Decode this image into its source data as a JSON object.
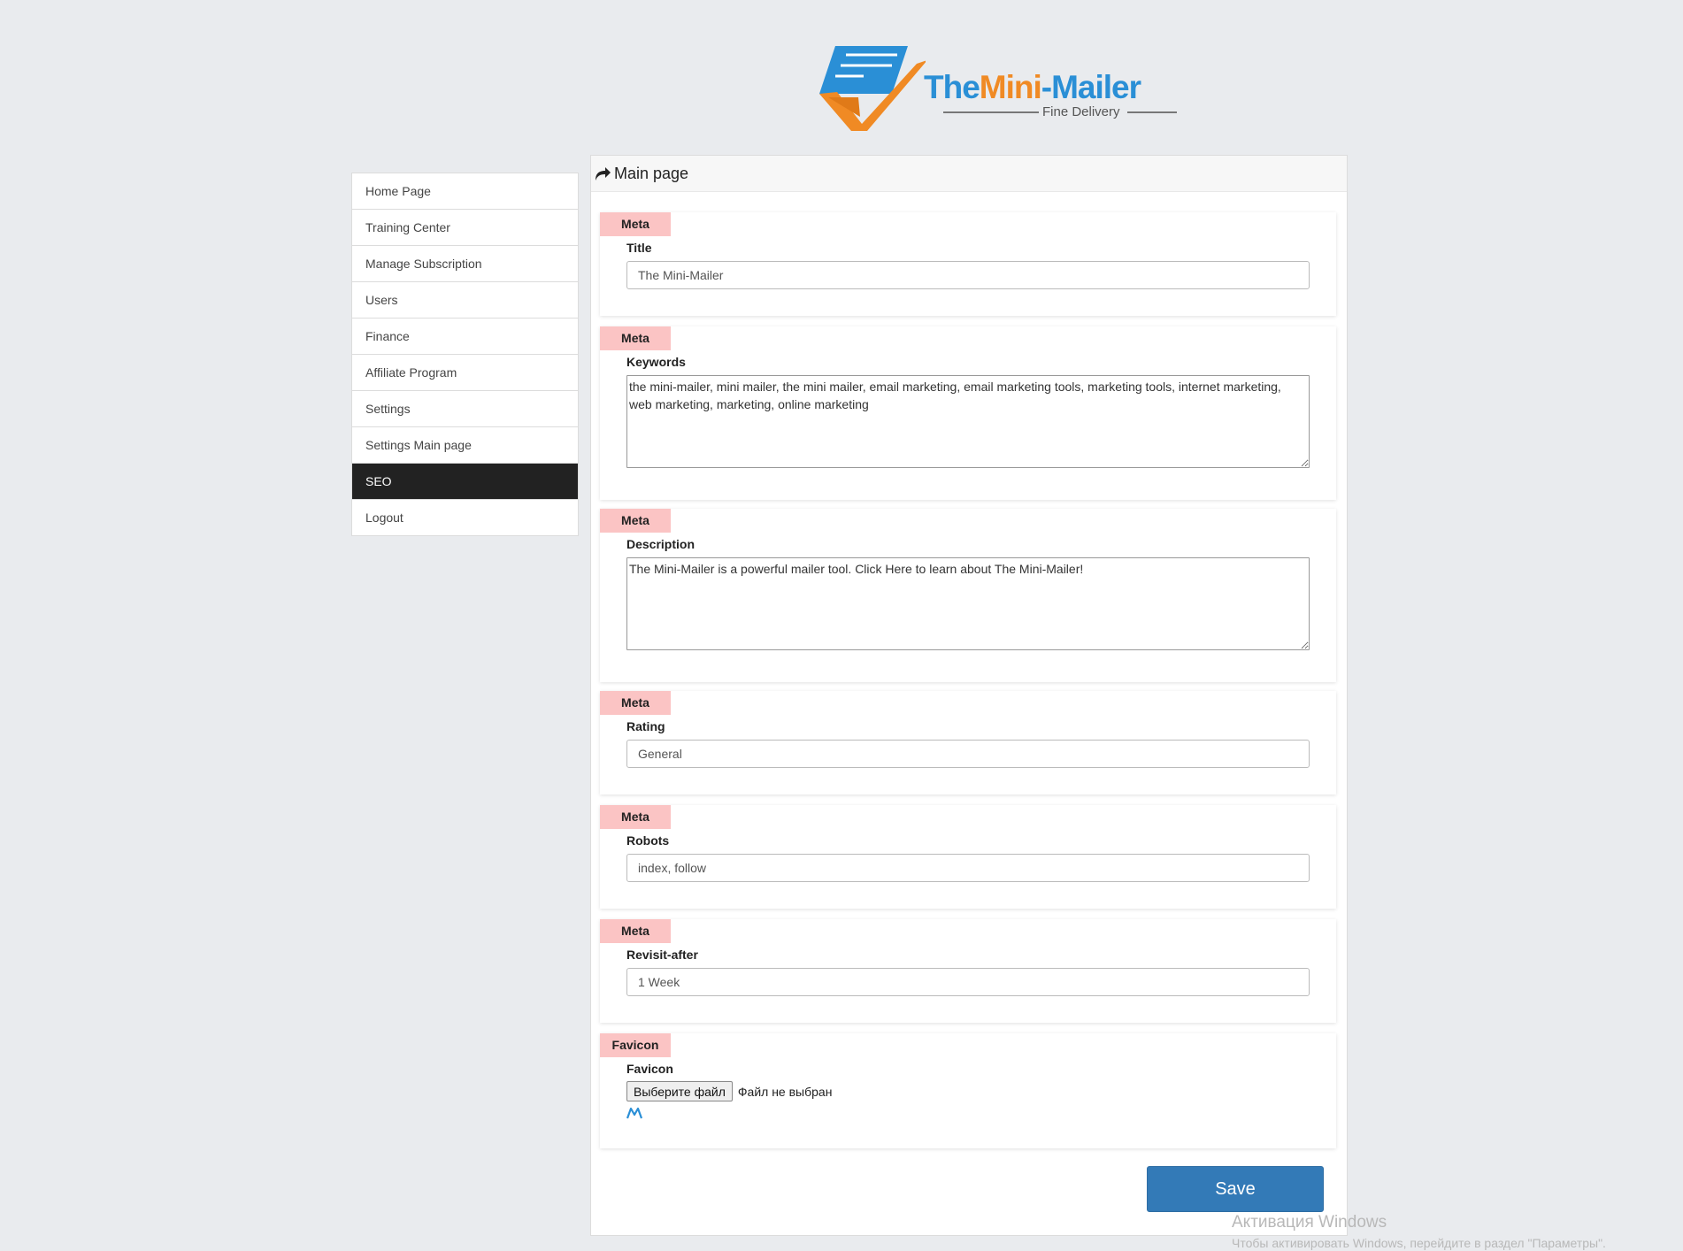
{
  "brand": {
    "name_part1": "The",
    "name_part2": "Mini",
    "name_part3": "-Mailer",
    "tagline": "Fine Delivery",
    "colors": {
      "blue": "#2a8fd6",
      "orange": "#f08a24"
    }
  },
  "sidebar": {
    "items": [
      {
        "label": "Home Page",
        "active": false
      },
      {
        "label": "Training Center",
        "active": false
      },
      {
        "label": "Manage Subscription",
        "active": false
      },
      {
        "label": "Users",
        "active": false
      },
      {
        "label": "Finance",
        "active": false
      },
      {
        "label": "Affiliate Program",
        "active": false
      },
      {
        "label": "Settings",
        "active": false
      },
      {
        "label": "Settings Main page",
        "active": false
      },
      {
        "label": "SEO",
        "active": true
      },
      {
        "label": "Logout",
        "active": false
      }
    ]
  },
  "panel": {
    "icon": "share-arrow-icon",
    "title": "Main page"
  },
  "fields": {
    "title": {
      "badge": "Meta",
      "label": "Title",
      "value": "The Mini-Mailer"
    },
    "keywords": {
      "badge": "Meta",
      "label": "Keywords",
      "value": "the mini-mailer, mini mailer, the mini mailer, email marketing, email marketing tools, marketing tools, internet marketing, web marketing, marketing, online marketing"
    },
    "description": {
      "badge": "Meta",
      "label": "Description",
      "value": "The Mini-Mailer is a powerful mailer tool. Click Here to learn about The Mini-Mailer!"
    },
    "rating": {
      "badge": "Meta",
      "label": "Rating",
      "value": "General"
    },
    "robots": {
      "badge": "Meta",
      "label": "Robots",
      "value": "index, follow"
    },
    "revisit": {
      "badge": "Meta",
      "label": "Revisit-after",
      "value": "1 Week"
    },
    "favicon": {
      "badge": "Favicon",
      "label": "Favicon",
      "button_label": "Выберите файл",
      "status": "Файл не выбран",
      "preview_icon": "mini-mailer-m-icon"
    }
  },
  "actions": {
    "save_label": "Save",
    "save_color": "#337ab7"
  },
  "watermark": {
    "title": "Активация Windows",
    "subtitle": "Чтобы активировать Windows, перейдите в раздел \"Параметры\"."
  }
}
